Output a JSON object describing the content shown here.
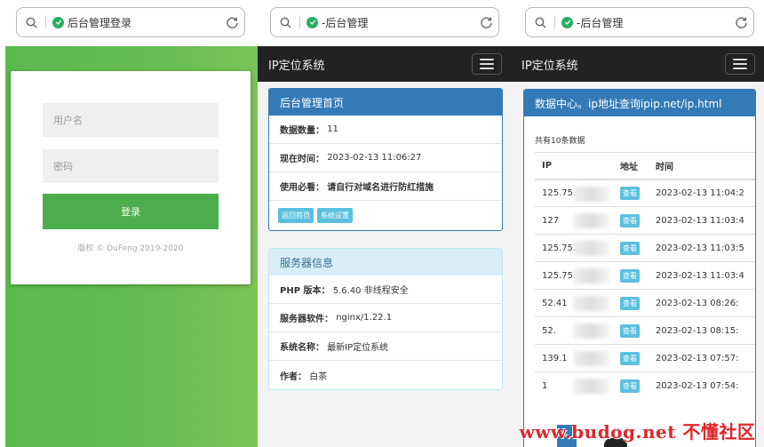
{
  "panel1": {
    "addressbar": {
      "title": "后台管理登录",
      "search_icon": "search-icon",
      "shield_icon": "shield-check-icon",
      "reload_icon": "reload-icon"
    },
    "login": {
      "username_placeholder": "用户名",
      "password_placeholder": "密码",
      "submit_label": "登录",
      "copyright": "版权 © DuFeng 2019-2020"
    },
    "colors": {
      "background": "#5ab94e",
      "button": "#4cad4c"
    }
  },
  "panel2": {
    "addressbar": {
      "title": "-后台管理"
    },
    "navbar": {
      "brand": "IP定位系统",
      "menu_icon": "hamburger-menu-icon"
    },
    "home_box": {
      "title": "后台管理首页",
      "rows": [
        {
          "label": "数据数量：",
          "value": "11"
        },
        {
          "label": "现在时间：",
          "value": "2023-02-13 11:06:27"
        },
        {
          "label": "使用必看：",
          "value": "请自行对域名进行防红措施"
        }
      ],
      "buttons": [
        "返回首页",
        "系统设置"
      ]
    },
    "server_box": {
      "title": "服务器信息",
      "rows": [
        {
          "label": "PHP 版本：",
          "value": "5.6.40 非线程安全"
        },
        {
          "label": "服务器软件：",
          "value": "nginx/1.22.1"
        },
        {
          "label": "系统名称：",
          "value": "最新IP定位系统"
        },
        {
          "label": "作者：",
          "value": "白茶"
        }
      ]
    }
  },
  "panel3": {
    "addressbar": {
      "title": "-后台管理"
    },
    "navbar": {
      "brand": "IP定位系统"
    },
    "data_box": {
      "title": "数据中心。ip地址查询ipip.net/ip.html",
      "count_text": "共有10条数据",
      "columns": [
        "IP",
        "地址",
        "时间"
      ],
      "view_label": "查看",
      "rows": [
        {
          "ip": "125.75.1",
          "time": "2023-02-13 11:04:2"
        },
        {
          "ip": "127",
          "time": "2023-02-13 11:03:4"
        },
        {
          "ip": "125.75.",
          "time": "2023-02-13 11:03:5"
        },
        {
          "ip": "125.75.",
          "time": "2023-02-13 11:03:4"
        },
        {
          "ip": "52.41",
          "time": "2023-02-13 08:26:"
        },
        {
          "ip": "52.",
          "time": "2023-02-13 08:15:"
        },
        {
          "ip": "139.1",
          "time": "2023-02-13 07:57:"
        },
        {
          "ip": "1",
          "time": "2023-02-13 07:54:"
        }
      ]
    },
    "watermark": "www.budog.net 不懂社区"
  }
}
